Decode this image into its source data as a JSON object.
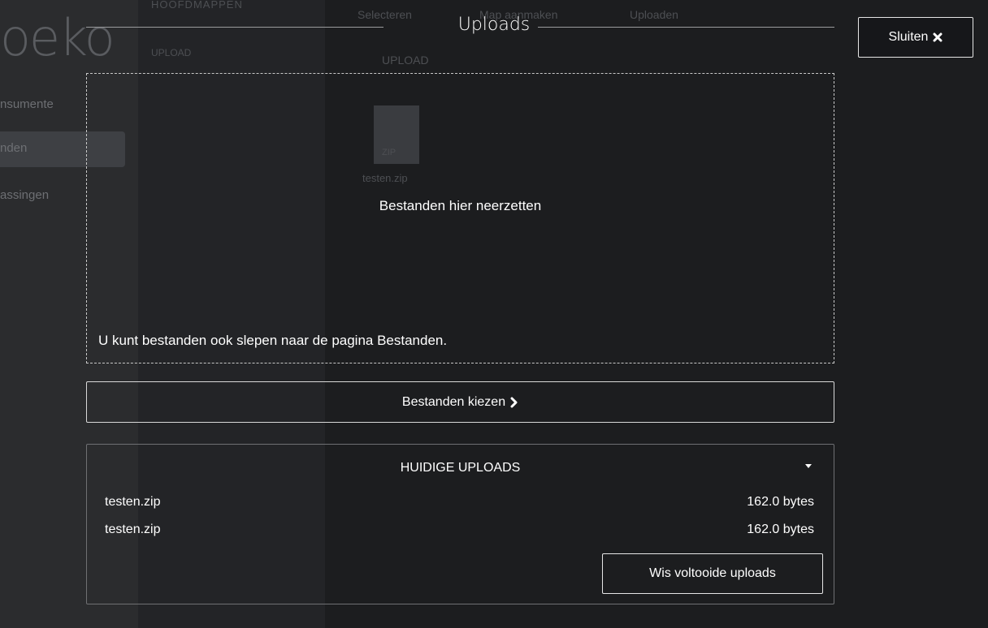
{
  "background": {
    "logo": "oeko",
    "nav_items": [
      "nsumente",
      "nden",
      "assingen"
    ],
    "folder_header": "HOOFDMAPPEN",
    "folder_item": "UPLOAD",
    "toolbar": [
      "Selecteren",
      "Map aanmaken",
      "Uploaden"
    ],
    "breadcrumb": "UPLOAD",
    "file_name": "testen.zip",
    "file_type": "ZIP"
  },
  "dialog": {
    "title": "Uploads",
    "close_label": "Sluiten",
    "dropzone_title": "Bestanden hier neerzetten",
    "dropzone_hint": "U kunt bestanden ook slepen naar de pagina Bestanden.",
    "choose_label": "Bestanden kiezen",
    "current_uploads": {
      "title": "HUIDIGE UPLOADS",
      "items": [
        {
          "name": "testen.zip",
          "size": "162.0 bytes"
        },
        {
          "name": "testen.zip",
          "size": "162.0 bytes"
        }
      ],
      "clear_label": "Wis voltooide uploads"
    }
  },
  "icons": {
    "close": "close-icon",
    "chevron": "chevron-right-icon",
    "toggle": "caret-down-icon"
  },
  "colors": {
    "background": "#1c1d1f",
    "text": "#ffffff",
    "border": "#d9d9d9"
  }
}
